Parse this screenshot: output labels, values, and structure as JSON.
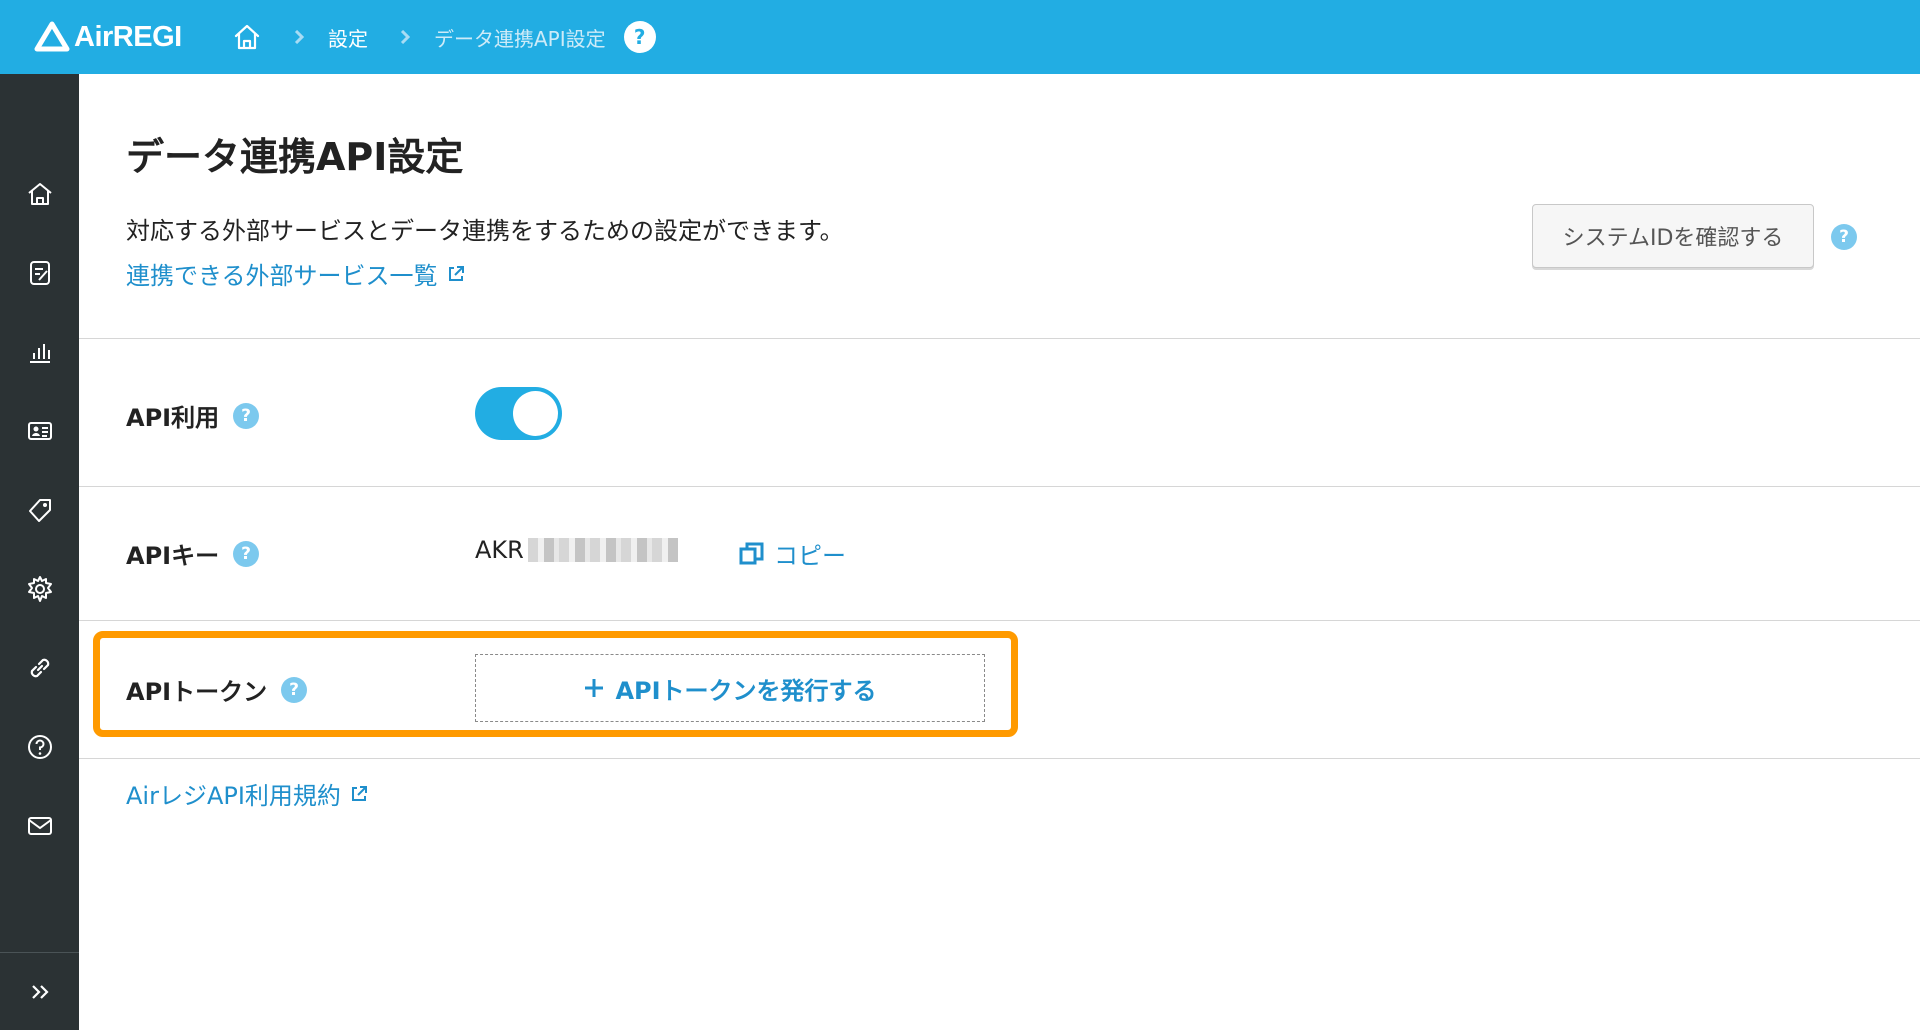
{
  "header": {
    "logo_text": "AirREGI",
    "breadcrumb": [
      "設定",
      "データ連携API設定"
    ],
    "help_glyph": "?",
    "brand_color": "#22ade3"
  },
  "sidebar": {
    "items": [
      "home-icon",
      "register-report-icon",
      "analytics-icon",
      "customer-card-icon",
      "tag-icon",
      "gear-icon",
      "link-icon",
      "help-icon",
      "mail-icon"
    ],
    "expand_glyph": ">>"
  },
  "page": {
    "title": "データ連携API設定",
    "description": "対応する外部サービスとデータ連携をするための設定ができます。",
    "services_link": "連携できる外部サービス一覧",
    "system_id_button": "システムIDを確認する",
    "help_glyph": "?"
  },
  "rows": {
    "api_usage": {
      "label": "API利用",
      "toggle_on": true
    },
    "api_key": {
      "label": "APIキー",
      "value_prefix": "AKR",
      "copy_label": "コピー"
    },
    "api_token": {
      "label": "APIトークン",
      "issue_button": "APIトークンを発行する"
    }
  },
  "footer": {
    "terms_link": "AirレジAPI利用規約"
  },
  "colors": {
    "accent": "#22ade3",
    "link": "#1f8fcc",
    "highlight": "#ff9a00",
    "sidebar": "#2b3234"
  }
}
